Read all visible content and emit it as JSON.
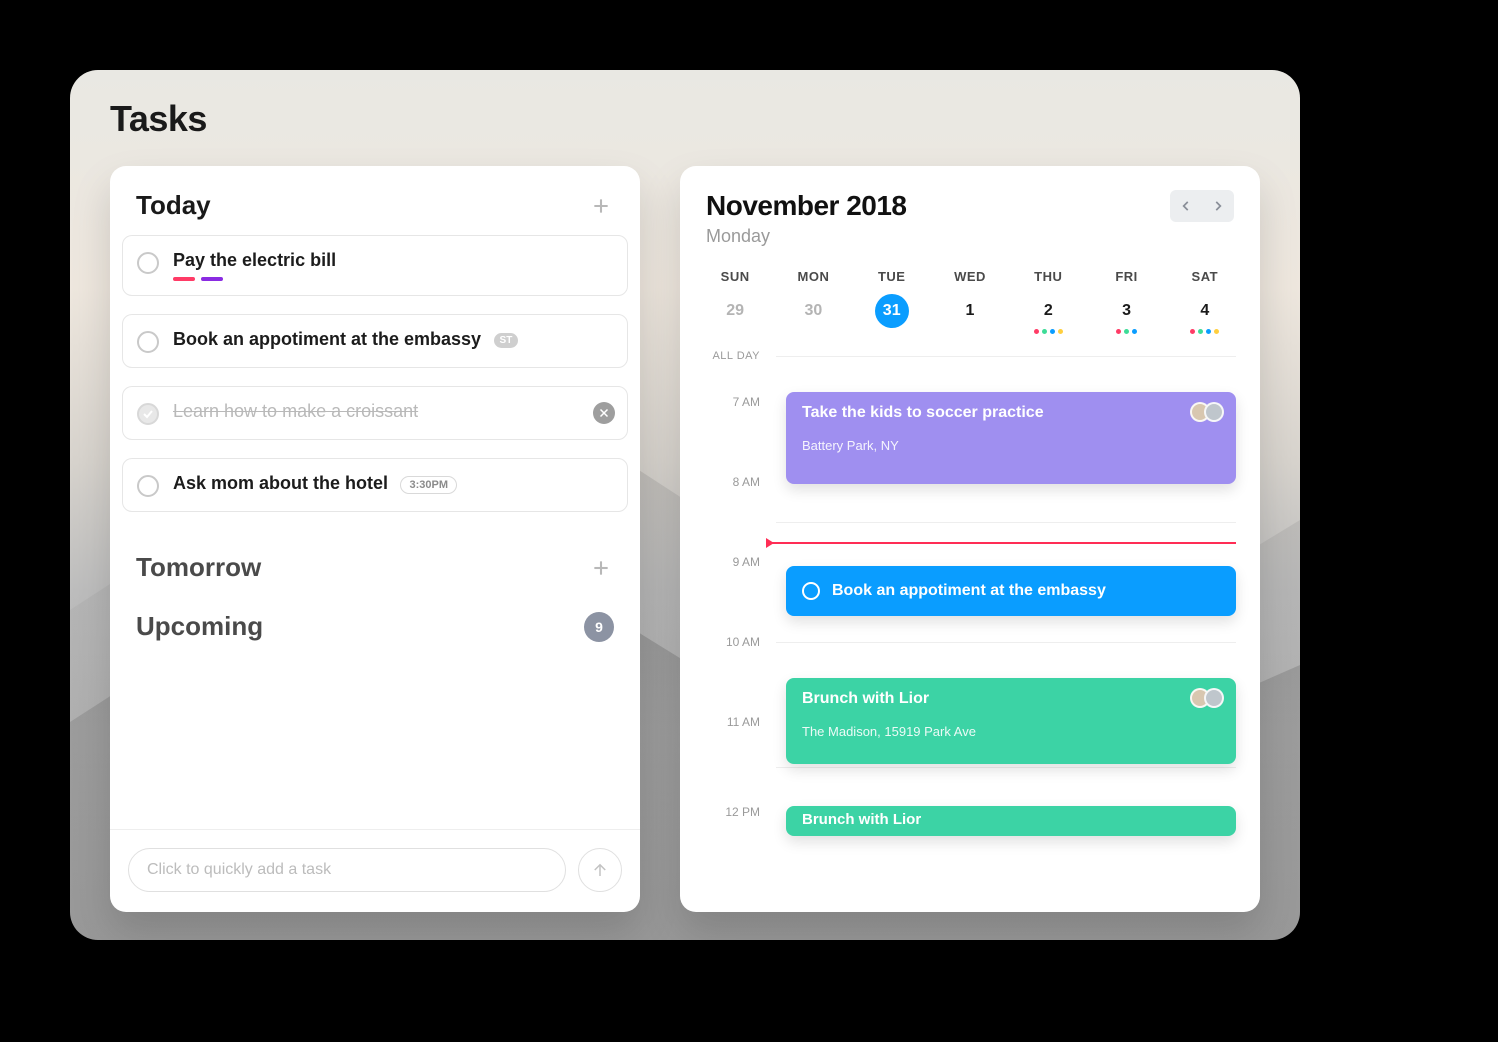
{
  "page_title": "Tasks",
  "tasks": {
    "today": {
      "heading": "Today",
      "items": [
        {
          "title": "Pay the electric bill",
          "done": false,
          "tags": [
            "red",
            "purple"
          ]
        },
        {
          "title": "Book an appotiment at the embassy",
          "done": false,
          "badge_abbrev": "ST"
        },
        {
          "title": "Learn how to make a croissant",
          "done": true,
          "deletable": true
        },
        {
          "title": "Ask mom about the hotel",
          "done": false,
          "time_pill": "3:30PM"
        }
      ]
    },
    "tomorrow": {
      "heading": "Tomorrow"
    },
    "upcoming": {
      "heading": "Upcoming",
      "count": "9"
    },
    "quick_add_placeholder": "Click to quickly add a task"
  },
  "calendar": {
    "month_title": "November 2018",
    "day_name": "Monday",
    "weekdays": [
      "SUN",
      "MON",
      "TUE",
      "WED",
      "THU",
      "FRI",
      "SAT"
    ],
    "dates": [
      {
        "n": "29",
        "dim": true
      },
      {
        "n": "30",
        "dim": true
      },
      {
        "n": "31",
        "dim": true,
        "active": true
      },
      {
        "n": "1"
      },
      {
        "n": "2",
        "dots": [
          "red",
          "green",
          "blue",
          "yellow"
        ]
      },
      {
        "n": "3",
        "dots": [
          "red",
          "green",
          "blue"
        ]
      },
      {
        "n": "4",
        "dots": [
          "red",
          "green",
          "blue",
          "yellow"
        ]
      }
    ],
    "time_labels": {
      "all_day": "ALL DAY",
      "h7": "7 AM",
      "h8": "8 AM",
      "h9": "9 AM",
      "h10": "10 AM",
      "h11": "11 AM",
      "h12": "12 PM"
    },
    "events": {
      "soccer": {
        "title": "Take the kids to soccer practice",
        "sub": "Battery Park, NY"
      },
      "embassy": {
        "title": "Book an appotiment at the embassy"
      },
      "brunch1": {
        "title": "Brunch with Lior",
        "sub": "The Madison, 15919 Park Ave"
      },
      "brunch2": {
        "title": "Brunch with Lior"
      }
    }
  }
}
